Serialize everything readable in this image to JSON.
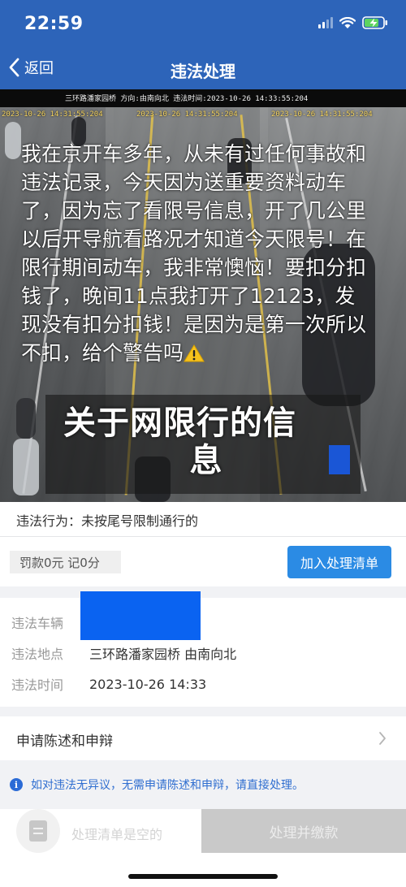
{
  "status_bar": {
    "time": "22:59"
  },
  "nav": {
    "back_label": "返回",
    "title": "违法处理"
  },
  "photo": {
    "camera_caption": "三环路潘家园桥  方向:由南向北  违法时间:2023-10-26 14:33:55:204",
    "camera_timestamps": [
      "2023-10-26 14:31:55:204",
      "2023-10-26 14:31:55:204",
      "2023-10-26 14:31:55:204"
    ],
    "caption_text": "我在京开车多年，从未有过任何事故和违法记录，今天因为送重要资料动车了，因为忘了看限号信息，开了几公里以后开导航看路况才知道今天限号！在限行期间动车，我非常懊恼！要扣分扣钱了，晚间11点我打开了12123，发现没有扣分扣钱！是因为是第一次所以不扣，给个警告吗",
    "overlay_title_line1": "关于网限行的信",
    "overlay_title_line2": "息"
  },
  "violation": {
    "behavior": "违法行为：未按尾号限制通行的",
    "penalty": "罚款0元  记0分",
    "add_button": "加入处理清单"
  },
  "details": {
    "vehicle_label": "违法车辆",
    "location_label": "违法地点",
    "location_value": "三环路潘家园桥 由南向北",
    "time_label": "违法时间",
    "time_value": "2023-10-26 14:33"
  },
  "appeal": {
    "label": "申请陈述和申辩"
  },
  "notice": {
    "text": "如对违法无异议，无需申请陈述和申辩，请直接处理。"
  },
  "bottom": {
    "cart_empty": "处理清单是空的",
    "pay_button": "处理并缴款"
  },
  "colors": {
    "header": "#2d64b9",
    "primary_button": "#2b8be4",
    "notice_text": "#2f6ed0",
    "plate_mask": "#0a63f1",
    "disabled_button": "#c9c9c9"
  },
  "icons": [
    "signal-icon",
    "wifi-icon",
    "battery-charging-icon",
    "back-chevron-icon",
    "warning-icon",
    "chevron-right-icon",
    "info-icon",
    "document-icon"
  ]
}
